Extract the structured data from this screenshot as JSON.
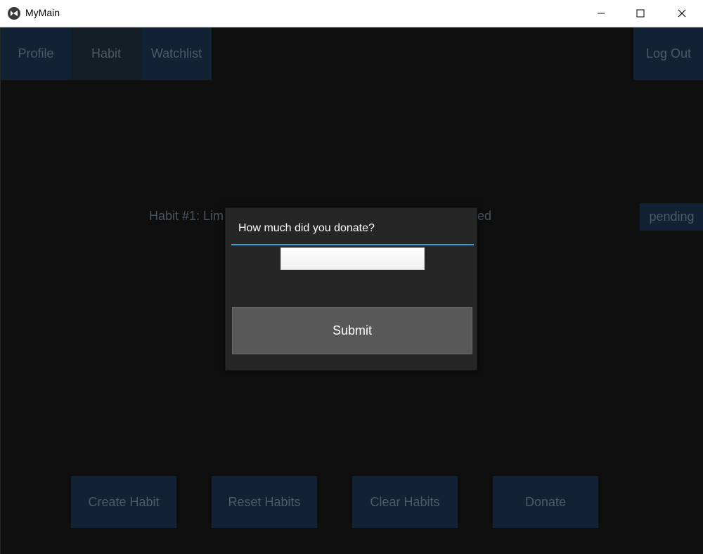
{
  "window": {
    "title": "MyMain",
    "icons": {
      "app": "kivy-logo-icon",
      "minimize": "minimize-icon",
      "maximize": "maximize-icon",
      "close": "close-icon"
    }
  },
  "nav": {
    "profile": "Profile",
    "habit": "Habit",
    "watchlist": "Watchlist",
    "logout": "Log Out"
  },
  "habit_row": {
    "text_left": "Habit #1: Lim",
    "text_right": "ed",
    "status": "pending"
  },
  "bottom_buttons": {
    "create": "Create Habit",
    "reset": "Reset Habits",
    "clear": "Clear Habits",
    "donate": "Donate"
  },
  "popup": {
    "title": "How much did you donate?",
    "input_value": "",
    "submit_label": "Submit"
  },
  "colors": {
    "background": "#0f0f10",
    "button_blue": "#122235",
    "popup_bg": "#262626",
    "popup_accent": "#33a3d4",
    "submit_bg": "#585858"
  }
}
